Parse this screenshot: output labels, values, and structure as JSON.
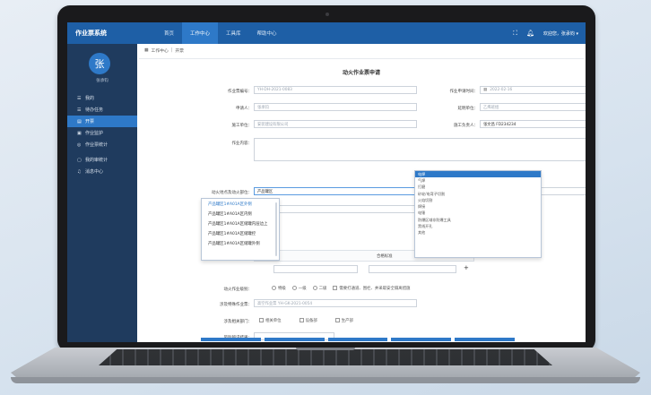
{
  "app": {
    "title": "作业票系统"
  },
  "nav": {
    "items": [
      "首页",
      "工作中心",
      "工具库",
      "帮助中心"
    ],
    "active": "工作中心"
  },
  "topbar": {
    "welcome": "欢迎您，张承钧 ▾"
  },
  "sidebar": {
    "avatar_char": "张",
    "user_name": "张承钧",
    "items": [
      {
        "icon": "☰",
        "label": "我的"
      },
      {
        "icon": "☰",
        "label": "待办任务"
      },
      {
        "icon": "▤",
        "label": "开票"
      },
      {
        "icon": "▣",
        "label": "作业监护"
      },
      {
        "icon": "◎",
        "label": "作业票统计"
      },
      {
        "icon": "▢",
        "label": "我的审统计"
      },
      {
        "icon": "♫",
        "label": "消息中心"
      }
    ],
    "active_index": 2
  },
  "breadcrumb": {
    "home": "工作中心",
    "sep": "|",
    "current": "开票"
  },
  "form": {
    "title": "动火作业票申请",
    "ticket_no_label": "作业票编号：",
    "ticket_no_value": "YH-DH-2021-0083",
    "apply_time_label": "作业申请时间：",
    "apply_time_value": "2022-02-16",
    "applicant_label": "申请人：",
    "applicant_value": "张承钧",
    "apply_unit_label": "延明单位：",
    "apply_unit_value": "乙烯班组",
    "construction_unit_label": "施工单位：",
    "construction_unit_value": "安装建设有限公司",
    "construction_lead_label": "施工负责人：",
    "construction_lead_value": "张文昌  FD234234",
    "content_label": "作业内容：",
    "location_label": "动火地点及动火部位：",
    "location_value": "产品罐区",
    "method_label": "动火方式：",
    "method_placeholder": "电焊",
    "start_time_label": "预计作业开始时间：",
    "end_time_label": "计划作业结束时间：",
    "analyst_label": "分析点名称：",
    "gas_label": "代表性气体及合格标准：",
    "gas_involve_label": "涉及有毒有害气体：",
    "table_pass_label": "合格标准",
    "level_label": "动火作业级别：",
    "level_options": [
      "特级",
      "一级",
      "二级"
    ],
    "level_check": "需要打通道、围栏、并采取安全隔离措施",
    "related_ticket_label": "涉及特殊作业票：",
    "related_ticket_value": "高空作业票 YH-GK-2021-0054",
    "related_dept_label": "涉及相关部门：",
    "related_depts": [
      "相关单位",
      "设备部",
      "生产部"
    ],
    "risk_label": "风险辨识结果："
  },
  "dropdown_left": {
    "items": [
      "产品罐区1#A01A区外侧",
      "产品罐区1#A01A区内侧",
      "产品罐区1#A01A区储罐内层边上",
      "产品罐区1#A01A区储罐控",
      "产品罐区1#A01A区储罐外侧"
    ],
    "selected_index": 0
  },
  "dropdown_right": {
    "items": [
      "电焊",
      "气焊",
      "打磨",
      "砂轮/电弯子切割",
      "火焰切割",
      "焊接",
      "电锤",
      "防爆区域非防爆工具",
      "黑线开孔",
      "其他"
    ],
    "selected_index": 0
  }
}
